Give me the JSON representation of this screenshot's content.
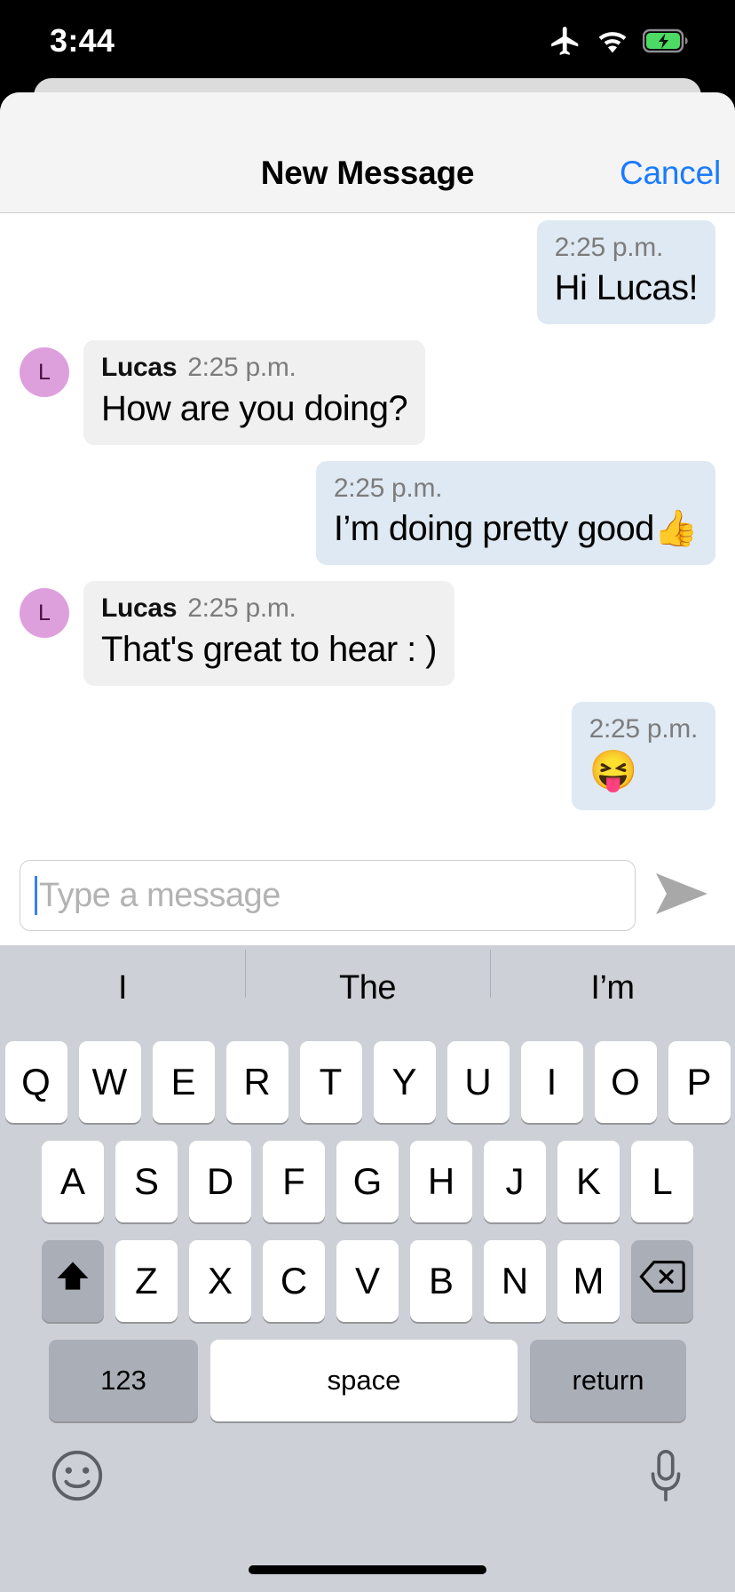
{
  "status_bar": {
    "time": "3:44",
    "icons": [
      "airplane-mode-icon",
      "wifi-icon",
      "battery-charging-icon"
    ],
    "battery_color": "#4cd964"
  },
  "sheet": {
    "title": "New Message",
    "cancel_label": "Cancel",
    "accent_color": "#1a7bff"
  },
  "conversation": {
    "messages": [
      {
        "direction": "outgoing",
        "time": "2:25 p.m.",
        "text": "Hi Lucas!",
        "bubble_color": "#dfe9f3"
      },
      {
        "direction": "incoming",
        "sender": "Lucas",
        "avatar_letter": "L",
        "avatar_color": "#dda0dd",
        "time": "2:25 p.m.",
        "text": "How are you doing?",
        "bubble_color": "#f0f0f0"
      },
      {
        "direction": "outgoing",
        "time": "2:25 p.m.",
        "text": "I’m doing pretty good👍",
        "bubble_color": "#dfe9f3"
      },
      {
        "direction": "incoming",
        "sender": "Lucas",
        "avatar_letter": "L",
        "avatar_color": "#dda0dd",
        "time": "2:25 p.m.",
        "text": "That's great to hear : )",
        "bubble_color": "#f0f0f0"
      },
      {
        "direction": "outgoing",
        "time": "2:25 p.m.",
        "text": "😝",
        "bubble_color": "#dfe9f3"
      }
    ]
  },
  "input_bar": {
    "placeholder": "Type a message",
    "value": "",
    "send_icon": "send-arrow-icon"
  },
  "keyboard": {
    "predictions": [
      "I",
      "The",
      "I’m"
    ],
    "row1": [
      "Q",
      "W",
      "E",
      "R",
      "T",
      "Y",
      "U",
      "I",
      "O",
      "P"
    ],
    "row2": [
      "A",
      "S",
      "D",
      "F",
      "G",
      "H",
      "J",
      "K",
      "L"
    ],
    "row3": [
      "Z",
      "X",
      "C",
      "V",
      "B",
      "N",
      "M"
    ],
    "shift_icon": "shift-up-arrow-icon",
    "backspace_icon": "backspace-delete-icon",
    "numeric_label": "123",
    "space_label": "space",
    "return_label": "return",
    "emoji_icon": "emoji-smiley-icon",
    "mic_icon": "microphone-icon"
  }
}
